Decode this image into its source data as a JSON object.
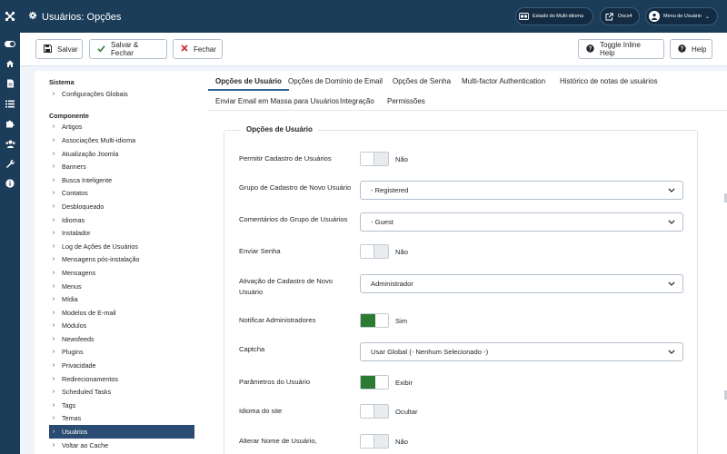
{
  "header": {
    "title": "Usuários: Opções",
    "buttons": {
      "multilang": "Estado do Multi-idioma",
      "docs": "Docs4",
      "user_menu": "Menu de Usuário"
    }
  },
  "toolbar": {
    "save": "Salvar",
    "save_close": "Salvar & Fechar",
    "close": "Fechar",
    "inline_help": "Toggle Inline Help",
    "help": "Help"
  },
  "tree": {
    "system_heading": "Sistema",
    "system_items": [
      "Configurações Globais"
    ],
    "component_heading": "Componente",
    "component_items": [
      "Artigos",
      "Associações Multi-idioma",
      "Atualização Joomla",
      "Banners",
      "Busca Inteligente",
      "Contatos",
      "Desbloqueado",
      "Idiomas",
      "Instalador",
      "Log de Ações de Usuários",
      "Mensagens pós-instalação",
      "Mensagens",
      "Menus",
      "Mídia",
      "Modelos de E-mail",
      "Módulos",
      "Newsfeeds",
      "Plugins",
      "Privacidade",
      "Redirecionamentos",
      "Scheduled Tasks",
      "Tags",
      "Temas",
      "Usuários",
      "Voltar ao Cache"
    ],
    "active_index": 23
  },
  "tabs": [
    "Opções de Usuário",
    "Opções de Domínio de Email",
    "Opções de Senha",
    "Multi-factor Authentication",
    "Histórico de notas de usuários",
    "Enviar Email em Massa para Usuários",
    "Integração",
    "Permissões"
  ],
  "active_tab": 0,
  "fieldset": {
    "legend": "Opções de Usuário",
    "rows": {
      "allow_registration": {
        "label": "Permitir Cadastro de Usuários",
        "state": "Não"
      },
      "new_user_group": {
        "label": "Grupo de Cadastro de Novo Usuário",
        "value": "- Registered"
      },
      "guest_group": {
        "label": "Comentários do Grupo de Usuários",
        "value": "- Guest"
      },
      "send_password": {
        "label": "Enviar Senha",
        "state": "Não"
      },
      "activation": {
        "label_line1": "Ativação de Cadastro de Novo",
        "label_line2": "Usuário",
        "value": "Administrador"
      },
      "notify_admins": {
        "label": "Notificar Administradores",
        "state": "Sim"
      },
      "captcha": {
        "label": "Captcha",
        "value": "Usar Global (- Nenhum Selecionado -)"
      },
      "user_params": {
        "label": "Parâmetros do Usuário",
        "state": "Exibir"
      },
      "site_language": {
        "label": "Idioma do site",
        "state": "Ocultar"
      },
      "change_username": {
        "label": "Alterar Nome de Usuário,",
        "state": "Não"
      }
    }
  },
  "colors": {
    "header_bg": "#1c3d5a",
    "accent": "#2a4b72",
    "switch_on": "#2d7a33"
  }
}
